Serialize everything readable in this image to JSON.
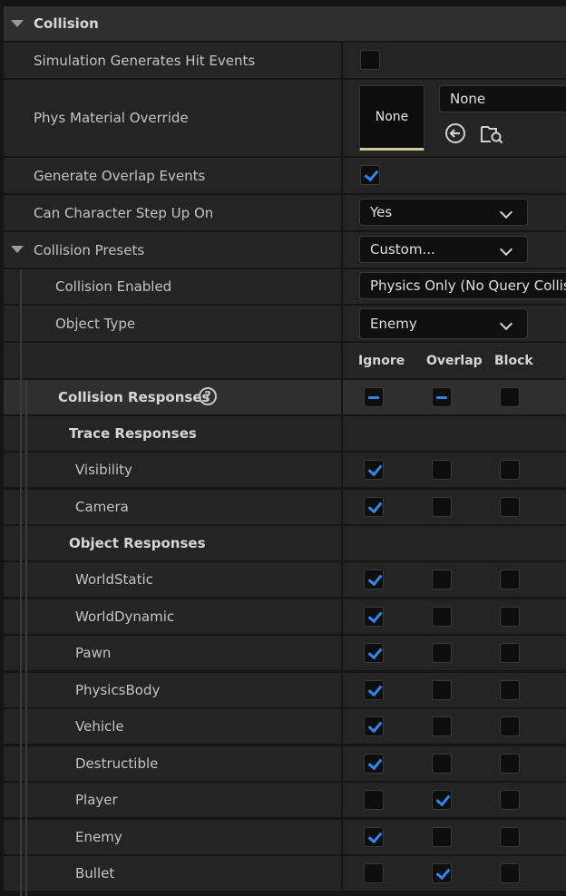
{
  "collision": {
    "title": "Collision",
    "sim_hit_events": {
      "label": "Simulation Generates Hit Events",
      "checked": false
    },
    "phys_material": {
      "label": "Phys Material Override",
      "thumb": "None",
      "value": "None"
    },
    "overlap_events": {
      "label": "Generate Overlap Events",
      "checked": true
    },
    "step_up": {
      "label": "Can Character Step Up On",
      "value": "Yes"
    },
    "presets": {
      "label": "Collision Presets",
      "value": "Custom..."
    },
    "enabled": {
      "label": "Collision Enabled",
      "value": "Physics Only (No Query Collision)"
    },
    "object_type": {
      "label": "Object Type",
      "value": "Enemy"
    },
    "columns": [
      "Ignore",
      "Overlap",
      "Block"
    ],
    "responses_label": "Collision Responses",
    "help_glyph": "?",
    "trace_label": "Trace Responses",
    "object_label": "Object Responses",
    "trace": [
      {
        "name": "Visibility",
        "ignore": true,
        "overlap": false,
        "block": false
      },
      {
        "name": "Camera",
        "ignore": true,
        "overlap": false,
        "block": false
      }
    ],
    "objects": [
      {
        "name": "WorldStatic",
        "ignore": true,
        "overlap": false,
        "block": false
      },
      {
        "name": "WorldDynamic",
        "ignore": true,
        "overlap": false,
        "block": false
      },
      {
        "name": "Pawn",
        "ignore": true,
        "overlap": false,
        "block": false
      },
      {
        "name": "PhysicsBody",
        "ignore": true,
        "overlap": false,
        "block": false
      },
      {
        "name": "Vehicle",
        "ignore": true,
        "overlap": false,
        "block": false
      },
      {
        "name": "Destructible",
        "ignore": true,
        "overlap": false,
        "block": false
      },
      {
        "name": "Player",
        "ignore": false,
        "overlap": true,
        "block": false
      },
      {
        "name": "Enemy",
        "ignore": true,
        "overlap": false,
        "block": false
      },
      {
        "name": "Bullet",
        "ignore": false,
        "overlap": true,
        "block": false
      }
    ]
  }
}
